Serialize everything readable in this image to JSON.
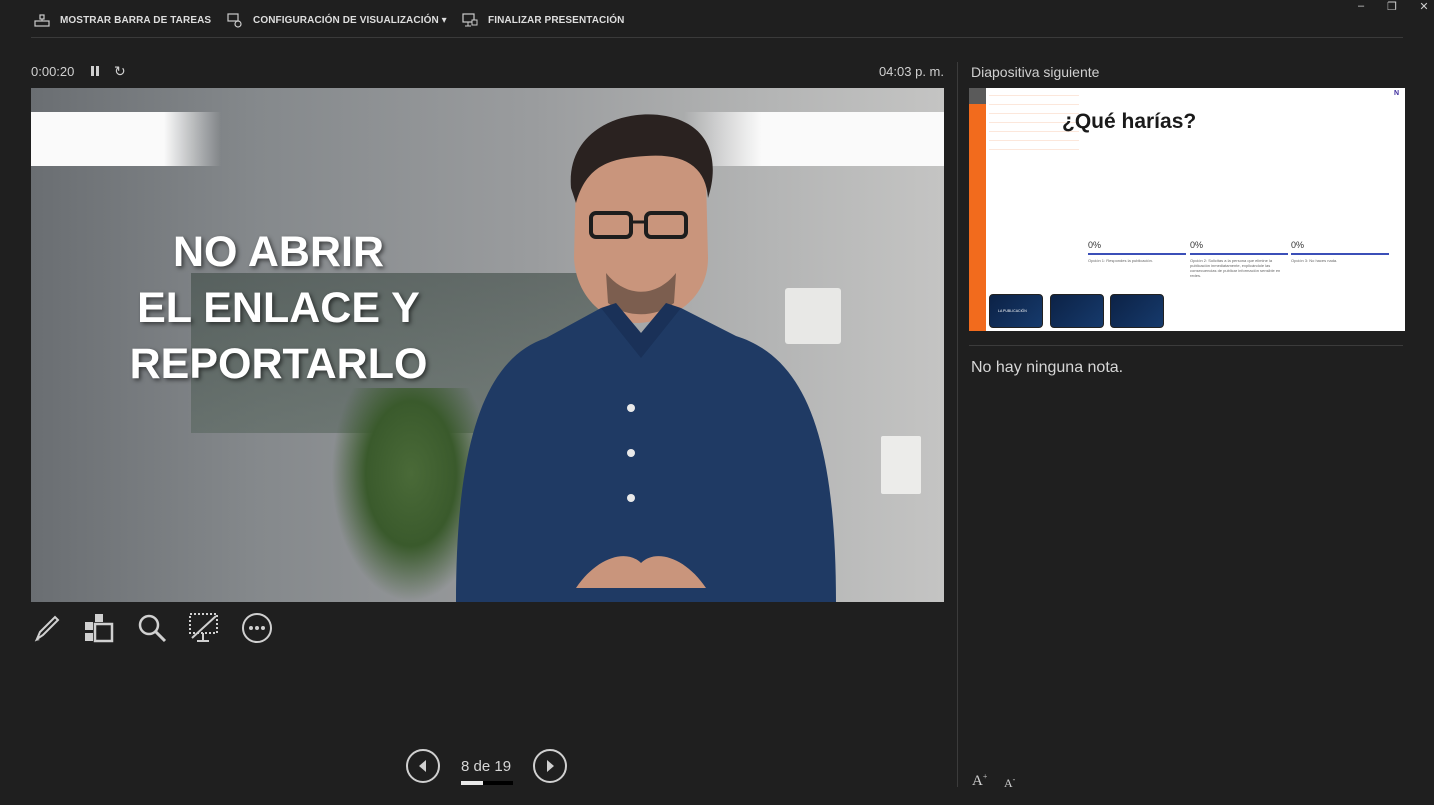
{
  "toolbar": {
    "show_taskbar": "MOSTRAR BARRA DE TAREAS",
    "display_settings": "CONFIGURACIÓN DE VISUALIZACIÓN ▾",
    "end_show": "FINALIZAR PRESENTACIÓN"
  },
  "window": {
    "minimize": "–",
    "restore": "❐",
    "close": "✕"
  },
  "timer": {
    "elapsed": "0:00:20",
    "clock": "04:03 p. m."
  },
  "slide": {
    "overlay_lines": [
      "NO ABRIR",
      "EL ENLACE Y",
      "REPORTARLO"
    ]
  },
  "tools": [
    "pen-icon",
    "slides-grid-icon",
    "zoom-icon",
    "black-screen-icon",
    "more-icon"
  ],
  "navigation": {
    "current": 8,
    "total": 19,
    "label": "8 de 19"
  },
  "next_slide": {
    "header": "Diapositiva siguiente",
    "question": "¿Qué harías?",
    "logo": "N",
    "options": [
      {
        "percent": "0%",
        "text": "Opción 1: Respondes la publicación."
      },
      {
        "percent": "0%",
        "text": "Opción 2: Solicitas a la persona que elimine la publicación inmediatamente, explicándole las consecuencias de publicar información sensible en redes."
      },
      {
        "percent": "0%",
        "text": "Opción 3: No haces nada."
      }
    ],
    "thumbnails": [
      "LA PUBLICACIÓN",
      "",
      ""
    ]
  },
  "notes": {
    "text": "No hay ninguna nota."
  },
  "font_controls": {
    "increase": "A",
    "decrease": "A"
  }
}
